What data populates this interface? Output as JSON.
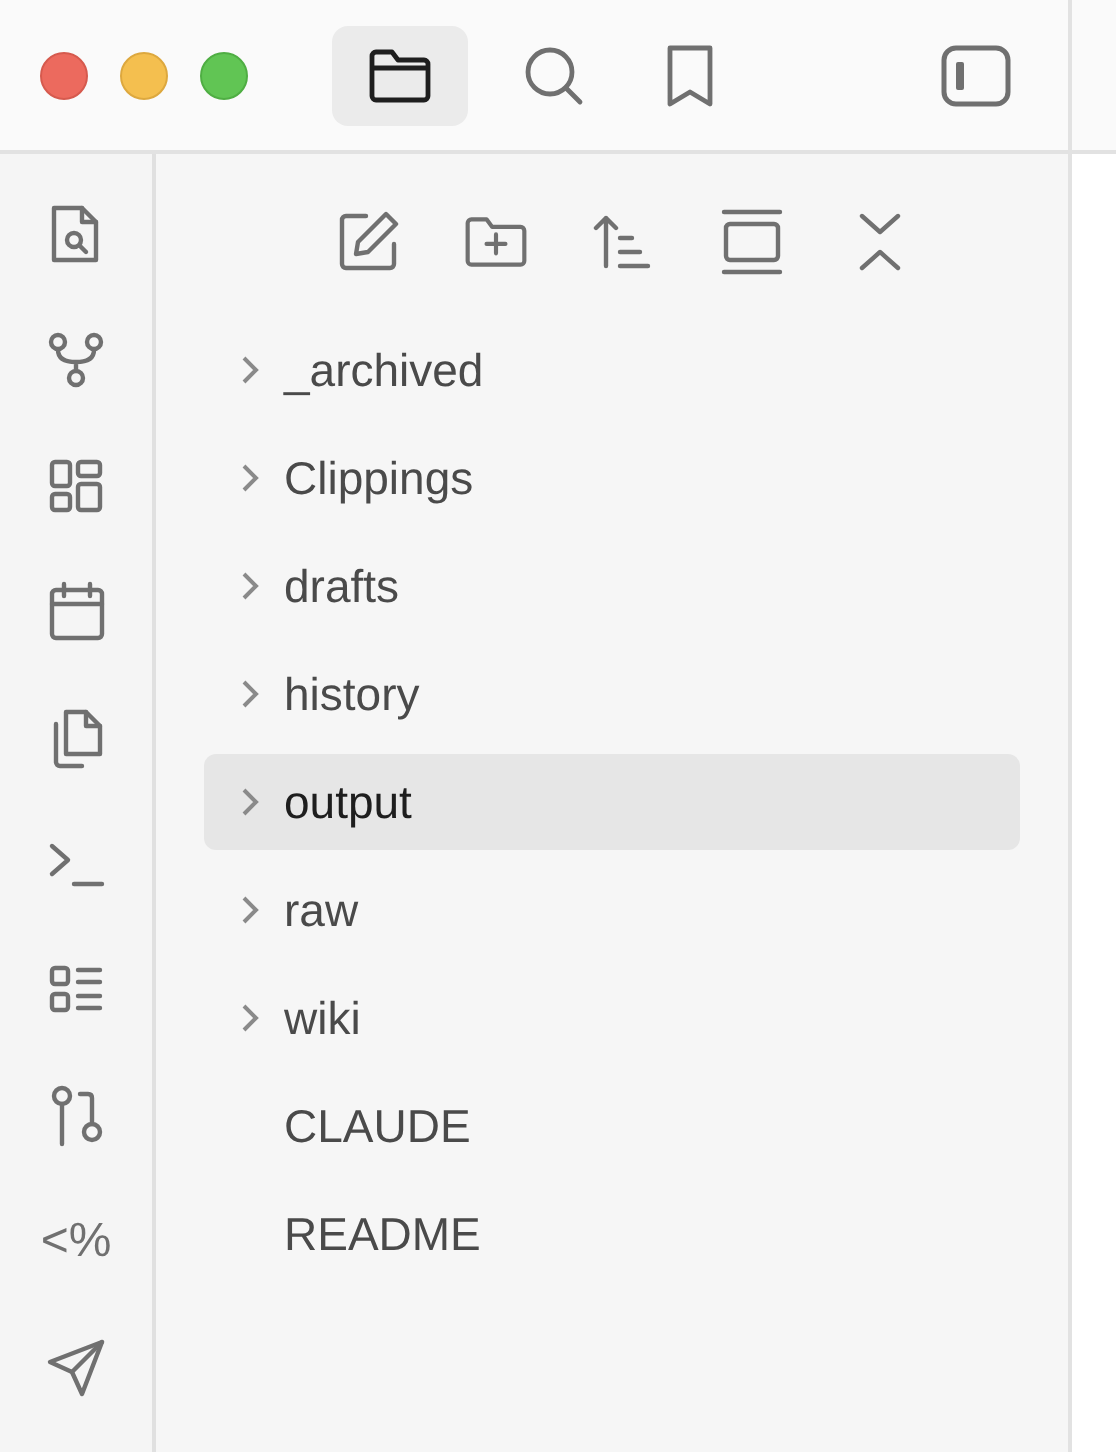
{
  "tabs": [
    {
      "selected": true
    },
    {
      "selected": false
    },
    {
      "selected": false
    }
  ],
  "ribbon_template": "<%",
  "tree": [
    {
      "label": "_archived",
      "kind": "folder",
      "expanded": false,
      "selected": false
    },
    {
      "label": "Clippings",
      "kind": "folder",
      "expanded": false,
      "selected": false
    },
    {
      "label": "drafts",
      "kind": "folder",
      "expanded": false,
      "selected": false
    },
    {
      "label": "history",
      "kind": "folder",
      "expanded": false,
      "selected": false
    },
    {
      "label": "output",
      "kind": "folder",
      "expanded": false,
      "selected": true
    },
    {
      "label": "raw",
      "kind": "folder",
      "expanded": false,
      "selected": false
    },
    {
      "label": "wiki",
      "kind": "folder",
      "expanded": false,
      "selected": false
    },
    {
      "label": "CLAUDE",
      "kind": "file",
      "selected": false
    },
    {
      "label": "README",
      "kind": "file",
      "selected": false
    }
  ]
}
